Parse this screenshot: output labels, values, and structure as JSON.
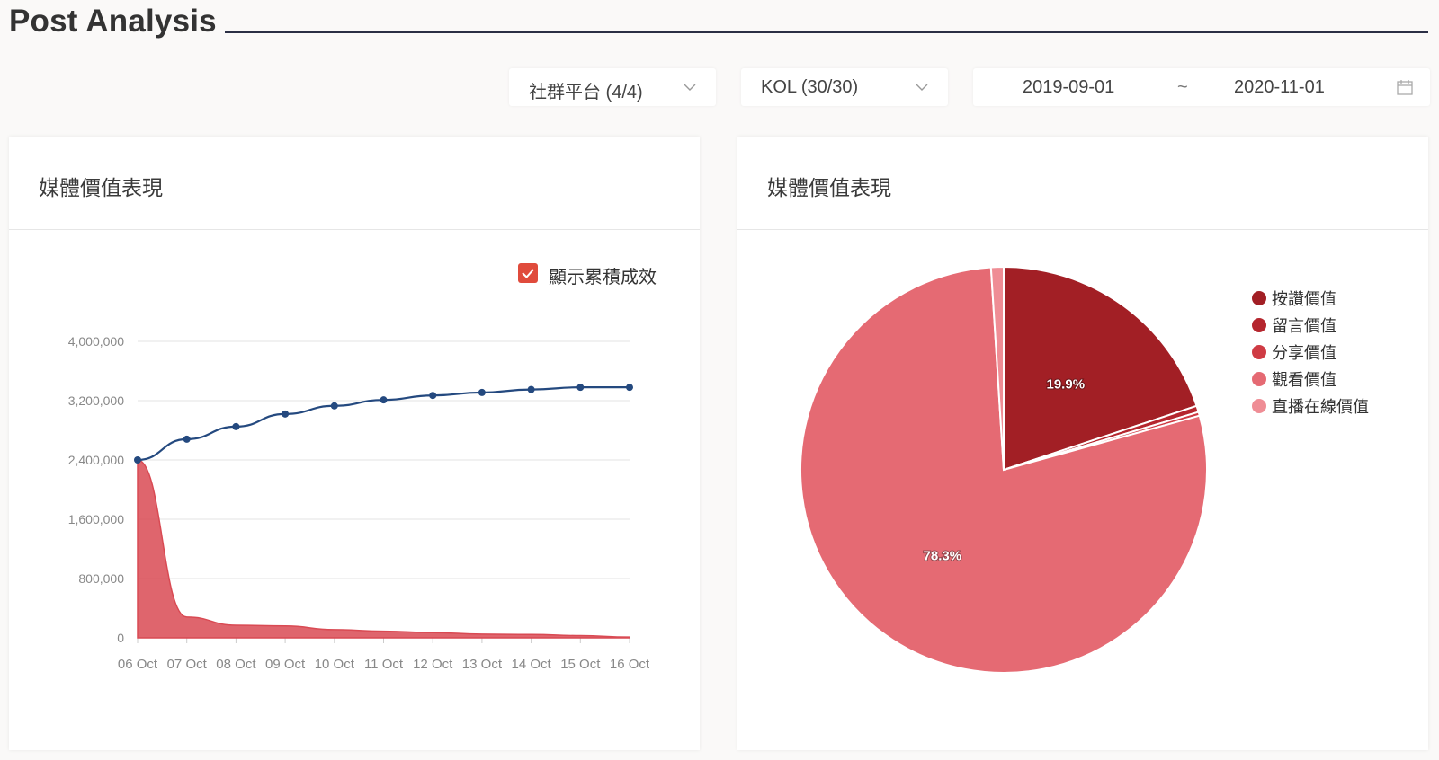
{
  "page": {
    "title": "Post Analysis"
  },
  "filters": {
    "platform": "社群平台 (4/4)",
    "kol": "KOL (30/30)",
    "date_start": "2019-09-01",
    "date_sep": "~",
    "date_end": "2020-11-01"
  },
  "left_card": {
    "title": "媒體價值表現",
    "checkbox_label": "顯示累積成效",
    "checkbox_checked": true
  },
  "right_card": {
    "title": "媒體價值表現"
  },
  "colors": {
    "line": "#24497f",
    "area": "#d94a53",
    "checkbox": "#e04b3c"
  },
  "chart_data": [
    {
      "type": "line",
      "categories": [
        "06 Oct",
        "07 Oct",
        "08 Oct",
        "09 Oct",
        "10 Oct",
        "11 Oct",
        "12 Oct",
        "13 Oct",
        "14 Oct",
        "15 Oct",
        "16 Oct"
      ],
      "y_ticks": [
        "0",
        "800,000",
        "1,600,000",
        "2,400,000",
        "3,200,000",
        "4,000,000"
      ],
      "ylim": [
        0,
        4000000
      ],
      "series": [
        {
          "kind": "cumulative",
          "color": "#24497f",
          "values": [
            2400000,
            2680000,
            2850000,
            3020000,
            3130000,
            3210000,
            3270000,
            3310000,
            3350000,
            3380000,
            3380000
          ]
        },
        {
          "kind": "daily",
          "color": "#d94a53",
          "values": [
            2400000,
            280000,
            170000,
            160000,
            110000,
            90000,
            70000,
            50000,
            45000,
            30000,
            10000
          ]
        }
      ]
    },
    {
      "type": "pie",
      "legend_position": "right",
      "slices": [
        {
          "name": "按讚價值",
          "value": 19.9,
          "label": "19.9%",
          "color": "#a21f25"
        },
        {
          "name": "留言價值",
          "value": 0.5,
          "color": "#b5262e"
        },
        {
          "name": "分享價值",
          "value": 0.3,
          "color": "#cf3b44"
        },
        {
          "name": "觀看價值",
          "value": 78.3,
          "label": "78.3%",
          "color": "#e56a73"
        },
        {
          "name": "直播在線價值",
          "value": 1.0,
          "color": "#ef8d95"
        }
      ]
    }
  ]
}
